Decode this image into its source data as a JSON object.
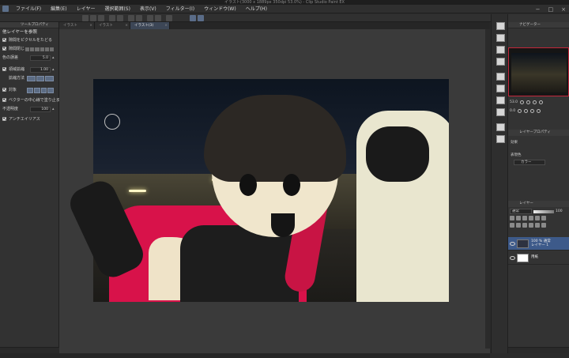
{
  "window": {
    "title": "イラスト(3000 x 1889px 350dpi 53.0%) - Clip Studio Paint EX"
  },
  "menu": [
    "ファイル(F)",
    "編集(E)",
    "レイヤー",
    "選択範囲(S)",
    "表示(V)",
    "フィルター(I)",
    "ウィンドウ(W)",
    "ヘルプ(H)"
  ],
  "tabs": [
    {
      "label": "イラスト",
      "active": false
    },
    {
      "label": "イラスト",
      "active": false
    },
    {
      "label": "イラスト(3)",
      "active": true
    }
  ],
  "tool_property": {
    "panel_title": "ツールプロパティ",
    "tool_title": "他レイヤーを参照",
    "options": [
      {
        "label": "隙間をピクセルをたどる",
        "checked": true
      },
      {
        "label": "隙間閉じ",
        "checked": true
      },
      {
        "label": "色の誤差",
        "value": "5.0"
      },
      {
        "label": "領域拡縮",
        "checked": true,
        "value": "1.00"
      },
      {
        "label": "拡縮方法"
      },
      {
        "label": "対象",
        "checked": true
      },
      {
        "label": "ベクターの中心線で塗り止まる",
        "checked": true
      },
      {
        "label": "不透明度",
        "value": "100"
      },
      {
        "label": "アンチエイリアス",
        "checked": true
      }
    ]
  },
  "navigator": {
    "panel_title": "ナビゲーター",
    "zoom": "53.0",
    "angle": "0.0"
  },
  "layer_property": {
    "panel_title": "レイヤープロパティ",
    "effect_label": "効果",
    "expression_label": "表現色",
    "expression_value": "カラー"
  },
  "layers_panel": {
    "panel_title": "レイヤー",
    "blend_mode": "通常",
    "opacity": "100",
    "layers": [
      {
        "name": "100 % 通常",
        "sub": "レイヤー 1",
        "selected": true
      },
      {
        "name": "用紙",
        "sub": "",
        "selected": false
      }
    ]
  },
  "colors": {
    "accent": "#c4263a",
    "selection": "#3d5a8a",
    "panel": "#323232"
  }
}
